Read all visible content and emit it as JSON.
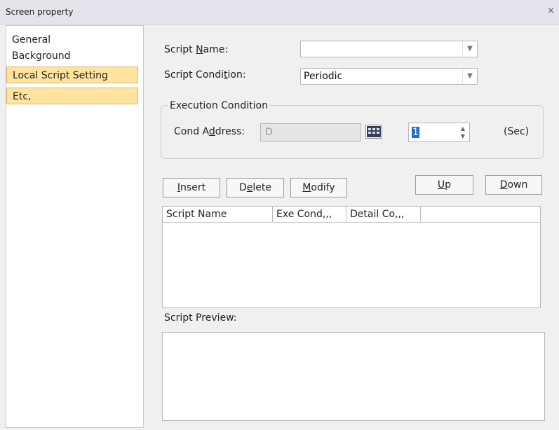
{
  "window": {
    "title": "Screen property",
    "close": "×"
  },
  "sidebar": {
    "items": [
      {
        "label": "General",
        "active": false
      },
      {
        "label": "Background",
        "active": false
      },
      {
        "label": "Local Script Setting",
        "active": true
      },
      {
        "label": "Etc,",
        "active": true
      }
    ]
  },
  "form": {
    "script_name": {
      "label": "Script Name:",
      "value": ""
    },
    "script_condition": {
      "label": "Script Condition:",
      "value": "Periodic"
    },
    "execution_condition": {
      "title": "Execution Condition",
      "cond_address_label": "Cond Address:",
      "cond_address_value": "D",
      "period_value": "1",
      "unit": "(Sec)"
    }
  },
  "buttons": {
    "insert": "Insert",
    "delete": "Delete",
    "modify": "Modify",
    "up": "Up",
    "down": "Down"
  },
  "table": {
    "columns": [
      "Script Name",
      "Exe Cond,,,",
      "Detail Co,,,"
    ],
    "rows": []
  },
  "preview": {
    "label": "Script Preview:"
  },
  "icons": {
    "close": "close-icon",
    "combo_arrow": "chevron-down-icon",
    "spin_up": "chevron-up-icon",
    "spin_down": "chevron-down-icon",
    "address_picker": "address-book-icon"
  },
  "colors": {
    "selection_bg": "#ffe4a0",
    "selection_border": "#e3b45e",
    "title_bar": "#e4e4ea"
  }
}
